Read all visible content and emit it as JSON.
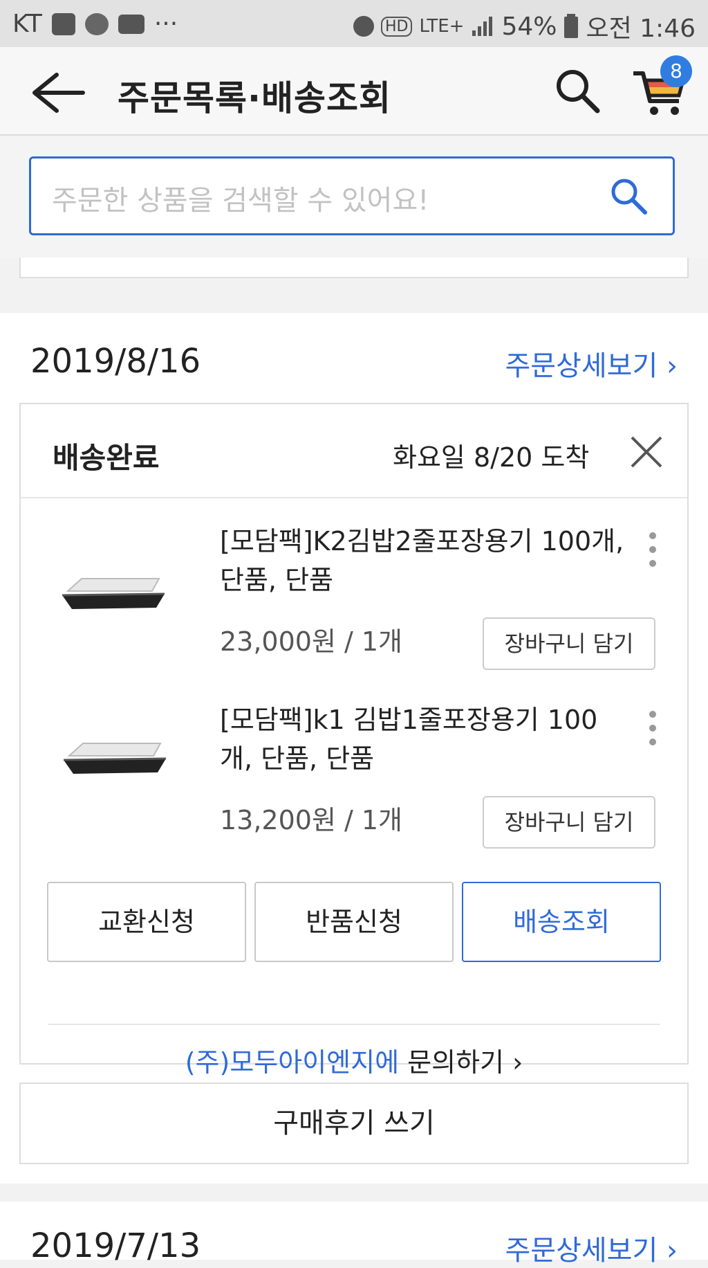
{
  "status_bar": {
    "carrier": "KT",
    "more": "···",
    "network": "LTE+",
    "battery": "54%",
    "time": "오전 1:46"
  },
  "header": {
    "title": "주문목록·배송조회",
    "cart_count": "8"
  },
  "search": {
    "placeholder": "주문한 상품을 검색할 수 있어요!"
  },
  "orders": [
    {
      "date": "2019/8/16",
      "detail_link": "주문상세보기",
      "status": "배송완료",
      "arrival": "화요일 8/20 도착",
      "items": [
        {
          "name": "[모담팩]K2김밥2줄포장용기 100개, 단품, 단품",
          "price": "23,000원 / 1개",
          "cart_label": "장바구니 담기"
        },
        {
          "name": "[모담팩]k1 김밥1줄포장용기 100개, 단품, 단품",
          "price": "13,200원 / 1개",
          "cart_label": "장바구니 담기"
        }
      ],
      "actions": {
        "exchange": "교환신청",
        "return": "반품신청",
        "tracking": "배송조회"
      },
      "seller": "(주)모두아이엔지에",
      "inquiry": "문의하기",
      "review": "구매후기 쓰기"
    },
    {
      "date": "2019/7/13",
      "detail_link": "주문상세보기"
    }
  ],
  "colors": {
    "accent": "#2f6ad8",
    "badge": "#2f7de1"
  }
}
